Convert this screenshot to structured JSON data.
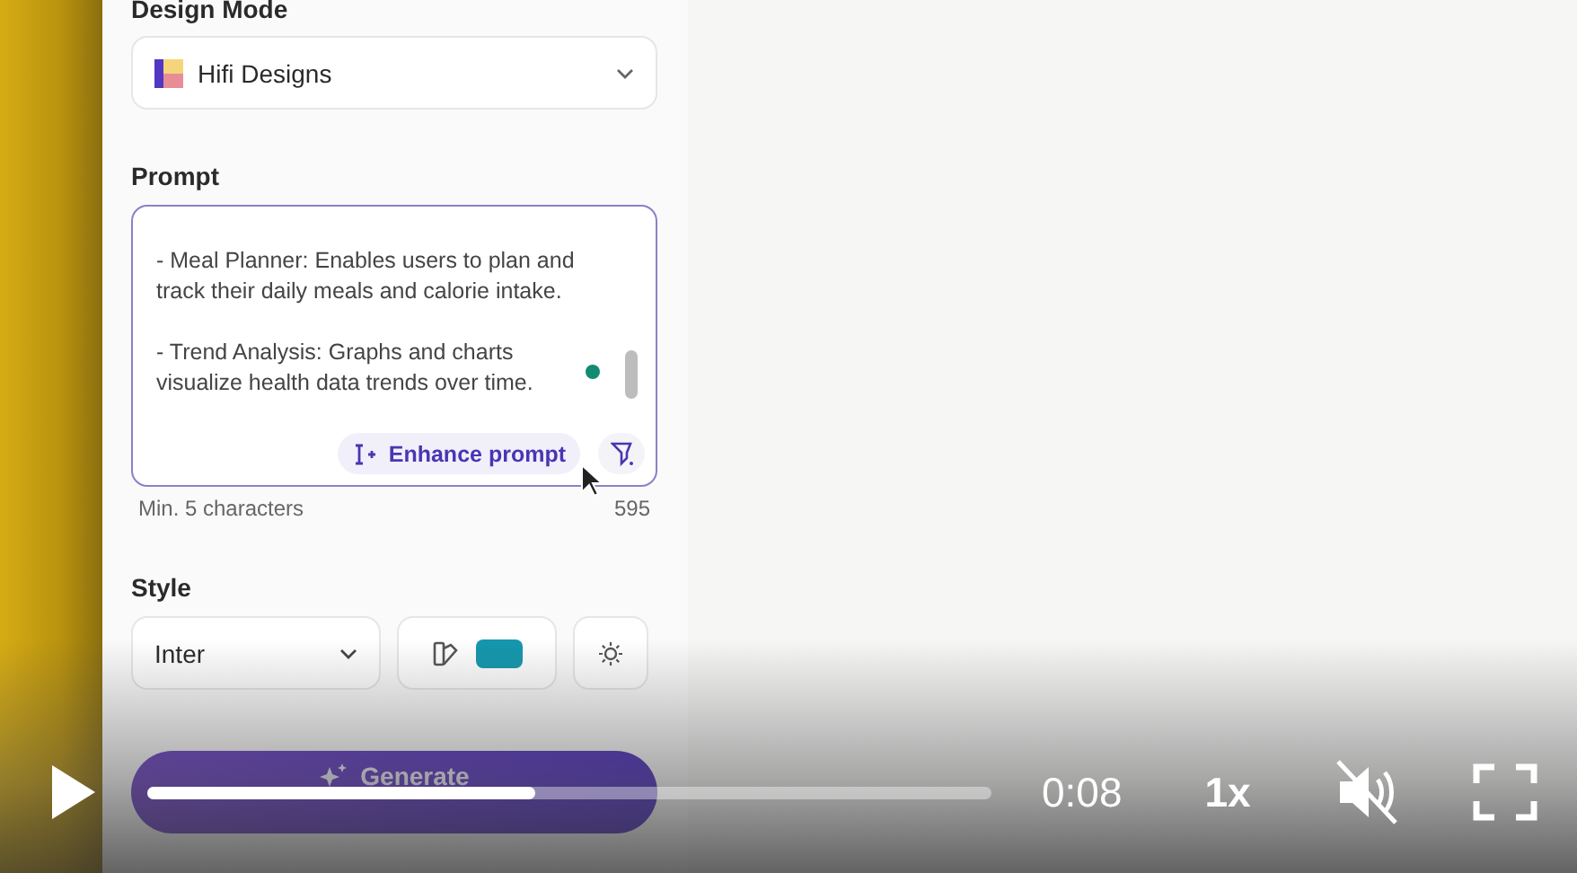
{
  "design_mode": {
    "label": "Design Mode",
    "value": "Hifi Designs"
  },
  "prompt": {
    "label": "Prompt",
    "value": "- Meal Planner: Enables users to plan and track their daily meals and calorie intake.\n\n- Trend Analysis: Graphs and charts visualize health data trends over time.",
    "enhance_button": "Enhance prompt",
    "hint": "Min. 5 characters",
    "count": "595"
  },
  "style": {
    "label": "Style",
    "font": "Inter",
    "color": "#1497ad"
  },
  "generate_button": "Generate",
  "player": {
    "playing": false,
    "level": 0.46,
    "time": "0:08",
    "speed": "1x",
    "muted": true
  }
}
